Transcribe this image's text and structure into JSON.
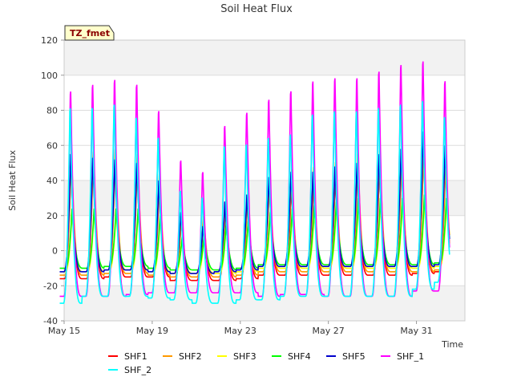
{
  "chart_data": {
    "type": "line",
    "title": "Soil Heat Flux",
    "xlabel": "Time",
    "ylabel": "Soil Heat Flux",
    "badge": "TZ_fmet",
    "ylim": [
      -40,
      120
    ],
    "xlim": [
      15,
      33.2
    ],
    "yticks": [
      -40,
      -20,
      0,
      20,
      40,
      60,
      80,
      100,
      120
    ],
    "xticks": [
      {
        "value": 15,
        "label": "May 15"
      },
      {
        "value": 19,
        "label": "May 19"
      },
      {
        "value": 23,
        "label": "May 23"
      },
      {
        "value": 27,
        "label": "May 27"
      },
      {
        "value": 31,
        "label": "May 31"
      }
    ],
    "grid": true,
    "legend_position": "bottom",
    "x_days": [
      15.3,
      16.3,
      17.3,
      18.3,
      19.3,
      20.3,
      21.3,
      22.3,
      23.3,
      24.3,
      25.3,
      26.3,
      27.3,
      28.3,
      29.3,
      30.3,
      31.3,
      32.3
    ],
    "series": [
      {
        "name": "SHF1",
        "color": "#ff0000",
        "peaks": [
          56,
          57,
          58,
          55,
          38,
          20,
          18,
          25,
          30,
          40,
          38,
          40,
          45,
          48,
          50,
          52,
          58,
          50
        ],
        "troughs": [
          -16,
          -16,
          -15,
          -15,
          -15,
          -17,
          -17,
          -17,
          -16,
          -14,
          -14,
          -14,
          -14,
          -14,
          -14,
          -14,
          -13,
          -12
        ]
      },
      {
        "name": "SHF2",
        "color": "#ff9900",
        "peaks": [
          60,
          60,
          60,
          58,
          48,
          22,
          24,
          30,
          32,
          45,
          50,
          52,
          55,
          60,
          62,
          62,
          64,
          58
        ],
        "troughs": [
          -14,
          -14,
          -13,
          -13,
          -14,
          -15,
          -15,
          -15,
          -14,
          -12,
          -12,
          -12,
          -12,
          -12,
          -12,
          -12,
          -12,
          -11
        ]
      },
      {
        "name": "SHF3",
        "color": "#ffff00",
        "peaks": [
          22,
          22,
          22,
          22,
          18,
          8,
          8,
          15,
          16,
          20,
          20,
          22,
          24,
          25,
          26,
          26,
          28,
          26
        ],
        "troughs": [
          -12,
          -12,
          -11,
          -11,
          -12,
          -13,
          -13,
          -13,
          -12,
          -10,
          -10,
          -10,
          -10,
          -10,
          -10,
          -10,
          -10,
          -9
        ]
      },
      {
        "name": "SHF4",
        "color": "#00ff00",
        "peaks": [
          24,
          24,
          24,
          24,
          20,
          8,
          10,
          16,
          17,
          22,
          24,
          26,
          28,
          30,
          30,
          30,
          32,
          30
        ],
        "troughs": [
          -10,
          -10,
          -9,
          -9,
          -10,
          -11,
          -11,
          -11,
          -10,
          -8,
          -8,
          -8,
          -8,
          -8,
          -8,
          -8,
          -8,
          -7
        ]
      },
      {
        "name": "SHF5",
        "color": "#0000cc",
        "peaks": [
          55,
          53,
          52,
          50,
          40,
          22,
          14,
          28,
          32,
          42,
          45,
          45,
          48,
          50,
          55,
          58,
          68,
          60
        ],
        "troughs": [
          -12,
          -12,
          -11,
          -11,
          -12,
          -13,
          -13,
          -12,
          -11,
          -9,
          -9,
          -9,
          -9,
          -9,
          -9,
          -9,
          -9,
          -8
        ]
      },
      {
        "name": "SHF_1",
        "color": "#ff00ff",
        "peaks": [
          98,
          102,
          105,
          102,
          86,
          56,
          49,
          77,
          85,
          93,
          98,
          104,
          106,
          106,
          110,
          114,
          116,
          104
        ],
        "troughs": [
          -26,
          -26,
          -26,
          -25,
          -24,
          -24,
          -24,
          -24,
          -24,
          -26,
          -25,
          -25,
          -26,
          -26,
          -26,
          -26,
          -23,
          -23
        ]
      },
      {
        "name": "SHF_2",
        "color": "#00ffff",
        "peaks": [
          88,
          88,
          90,
          82,
          70,
          38,
          34,
          65,
          66,
          70,
          72,
          84,
          86,
          86,
          88,
          90,
          92,
          82
        ],
        "troughs": [
          -30,
          -26,
          -26,
          -26,
          -27,
          -28,
          -30,
          -30,
          -28,
          -28,
          -26,
          -26,
          -26,
          -26,
          -26,
          -26,
          -22,
          -18
        ]
      }
    ]
  }
}
